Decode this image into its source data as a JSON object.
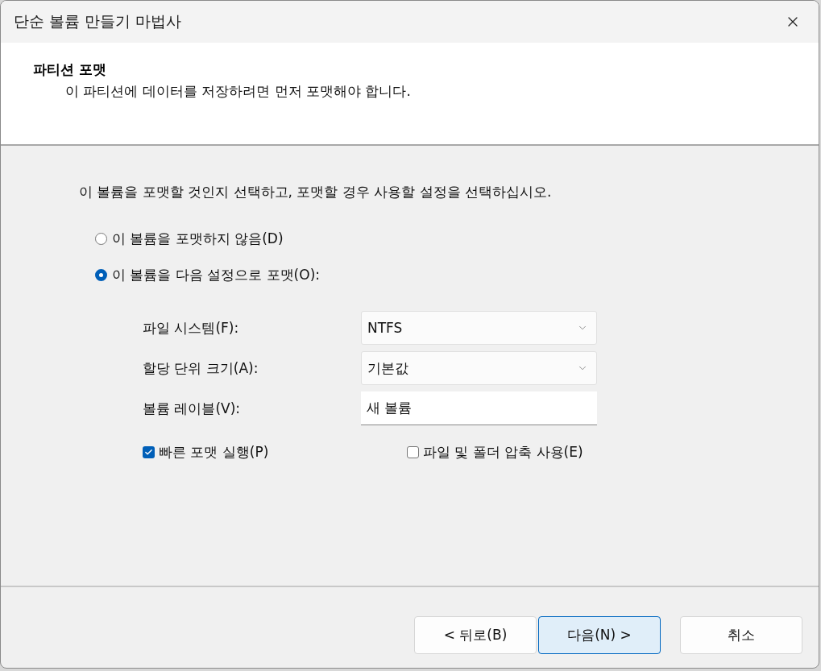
{
  "window": {
    "title": "단순 볼륨 만들기 마법사"
  },
  "header": {
    "title": "파티션 포맷",
    "subtitle": "이 파티션에 데이터를 저장하려면 먼저 포맷해야 합니다."
  },
  "instruction": "이 볼륨을 포맷할 것인지 선택하고, 포맷할 경우 사용할 설정을 선택하십시오.",
  "format_options": [
    {
      "label": "이 볼륨을 포맷하지 않음(D)",
      "selected": false
    },
    {
      "label": "이 볼륨을 다음 설정으로 포맷(O):",
      "selected": true
    }
  ],
  "settings": [
    {
      "kind": "dropdown",
      "label": "파일 시스템(F):",
      "value": "NTFS"
    },
    {
      "kind": "dropdown",
      "label": "할당 단위 크기(A):",
      "value": "기본값"
    },
    {
      "kind": "text",
      "label": "볼륨 레이블(V):",
      "value": "새 볼륨"
    }
  ],
  "checkboxes": [
    {
      "label": "빠른 포맷 실행(P)",
      "checked": true
    },
    {
      "label": "파일 및 폴더 압축 사용(E)",
      "checked": false
    }
  ],
  "buttons": [
    {
      "label": "< 뒤로(B)",
      "default": false
    },
    {
      "label": "다음(N) >",
      "default": true
    },
    {
      "label": "취소",
      "default": false
    }
  ]
}
